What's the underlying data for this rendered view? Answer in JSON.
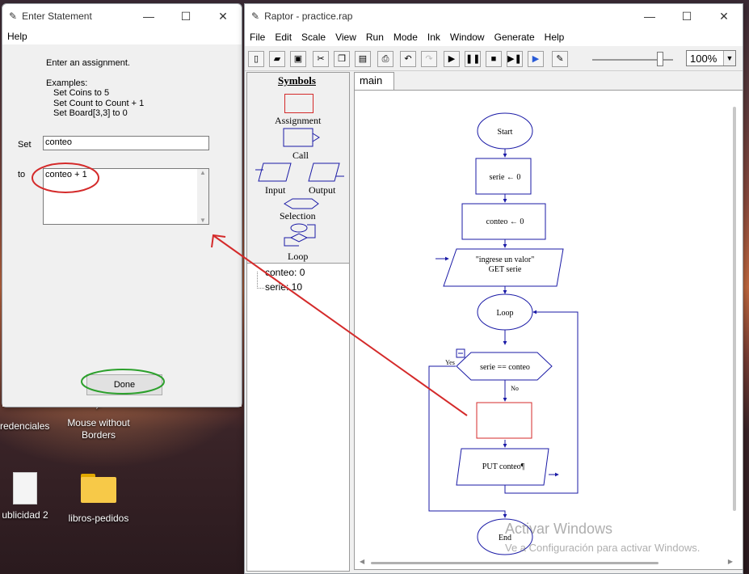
{
  "desktop": {
    "icons": [
      {
        "label": "redenciales"
      },
      {
        "label": "Mouse without\nBorders"
      },
      {
        "label": "ublicidad 2"
      },
      {
        "label": "libros-pedidos"
      }
    ]
  },
  "dialog": {
    "title": "Enter Statement",
    "menu_help": "Help",
    "instruction": "Enter an assignment.",
    "examples_heading": "Examples:",
    "example_1": "Set Coins to 5",
    "example_2": "Set Count to Count + 1",
    "example_3": "Set Board[3,3] to 0",
    "set_label": "Set",
    "set_value": "conteo",
    "to_label": "to",
    "to_value": "conteo + 1",
    "done_label": "Done"
  },
  "raptor": {
    "title": "Raptor - practice.rap",
    "menu": [
      "File",
      "Edit",
      "Scale",
      "View",
      "Run",
      "Mode",
      "Ink",
      "Window",
      "Generate",
      "Help"
    ],
    "zoom": "100%",
    "symbols_heading": "Symbols",
    "sym_assignment": "Assignment",
    "sym_call": "Call",
    "sym_input": "Input",
    "sym_output": "Output",
    "sym_selection": "Selection",
    "sym_loop": "Loop",
    "vars": [
      "conteo: 0",
      "serie: 10"
    ],
    "tab_main": "main",
    "flow": {
      "start": "Start",
      "assign1": "serie ← 0",
      "assign2": "conteo ← 0",
      "input_prompt": "\"ingrese un valor\"",
      "input_get": "GET serie",
      "loop": "Loop",
      "yes": "Yes",
      "cond": "serie == conteo",
      "no": "No",
      "put": "PUT conteo¶",
      "end": "End"
    }
  },
  "watermark": {
    "line1": "Activar Windows",
    "line2": "Ve a Configuración para activar Windows."
  },
  "colors": {
    "flow_blue": "#1a1aa6",
    "annotation_red": "#d42a2a",
    "annotation_green": "#2ca02c"
  }
}
